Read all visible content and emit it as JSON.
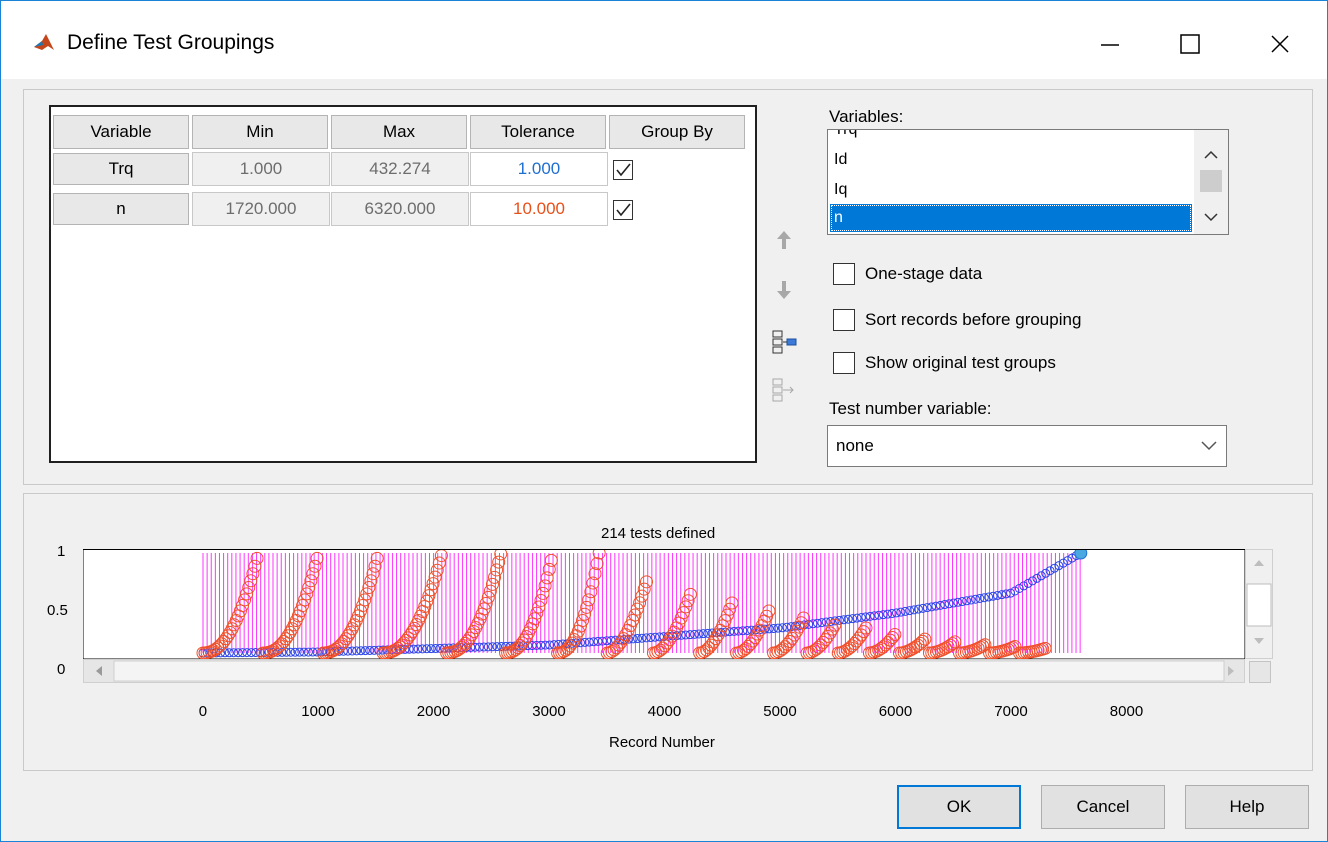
{
  "window": {
    "title": "Define Test Groupings"
  },
  "table": {
    "headers": [
      "Variable",
      "Min",
      "Max",
      "Tolerance",
      "Group By"
    ],
    "rows": [
      {
        "variable": "Trq",
        "min": "1.000",
        "max": "432.274",
        "tolerance": "1.000",
        "tolerance_color": "#1f6fd0",
        "group_by": true
      },
      {
        "variable": "n",
        "min": "1720.000",
        "max": "6320.000",
        "tolerance": "10.000",
        "tolerance_color": "#e8501a",
        "group_by": true
      }
    ]
  },
  "variables": {
    "label": "Variables:",
    "items": [
      "Trq",
      "Id",
      "Iq",
      "n"
    ],
    "selected": "n"
  },
  "options": {
    "one_stage": "One-stage data",
    "sort_records": "Sort records before grouping",
    "show_original": "Show original test groups"
  },
  "test_number": {
    "label": "Test number variable:",
    "value": "none"
  },
  "plot": {
    "title": "214 tests defined",
    "xlabel": "Record Number",
    "xticks": [
      "0",
      "1000",
      "2000",
      "3000",
      "4000",
      "5000",
      "6000",
      "7000",
      "8000"
    ],
    "yticks": [
      "1",
      "0.5",
      "0"
    ]
  },
  "chart_data": {
    "type": "scatter",
    "title": "214 tests defined",
    "xlabel": "Record Number",
    "ylabel": "",
    "xlim": [
      -1000,
      8500
    ],
    "ylim": [
      0,
      1
    ],
    "series": [
      {
        "name": "",
        "color": "#2a44e8",
        "description_points": [
          [
            0,
            0.0
          ],
          [
            1000,
            0.01
          ],
          [
            3000,
            0.08
          ],
          [
            5000,
            0.25
          ],
          [
            6000,
            0.4
          ],
          [
            7000,
            0.6
          ],
          [
            7600,
            1.0
          ]
        ]
      },
      {
        "name": "",
        "color": "#f0502a",
        "group_ends_x": [
          480,
          1000,
          1520,
          2070,
          2580,
          3030,
          3430
        ]
      }
    ]
  },
  "buttons": {
    "ok": "OK",
    "cancel": "Cancel",
    "help": "Help"
  }
}
